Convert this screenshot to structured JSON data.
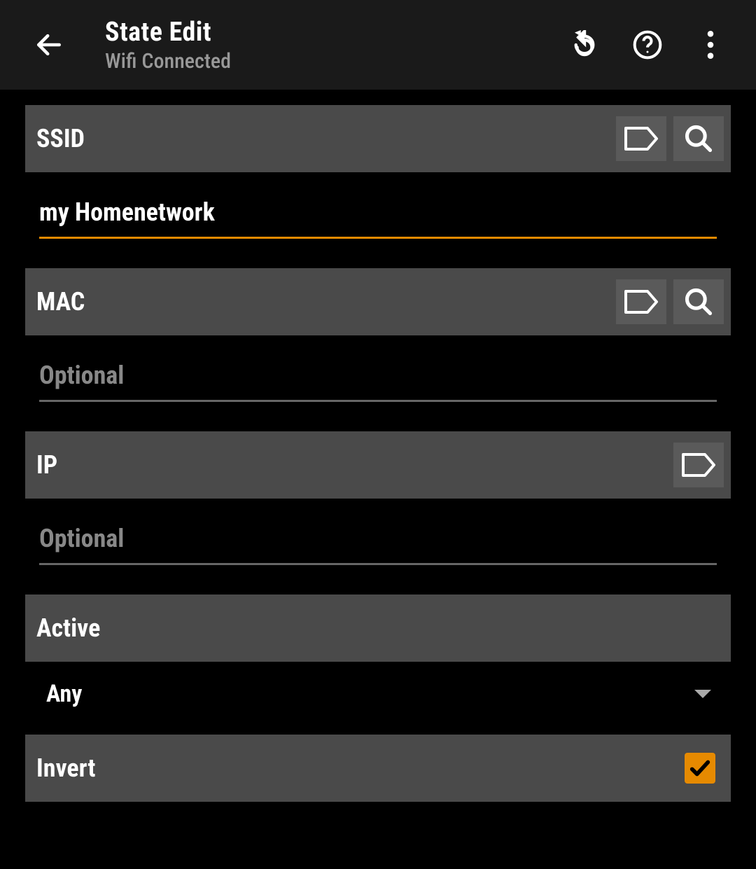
{
  "header": {
    "title": "State Edit",
    "subtitle": "Wifi Connected"
  },
  "ssid": {
    "label": "SSID",
    "value": "my Homenetwork"
  },
  "mac": {
    "label": "MAC",
    "placeholder": "Optional",
    "value": ""
  },
  "ip": {
    "label": "IP",
    "placeholder": "Optional",
    "value": ""
  },
  "active": {
    "label": "Active",
    "value": "Any"
  },
  "invert": {
    "label": "Invert",
    "checked": true
  }
}
